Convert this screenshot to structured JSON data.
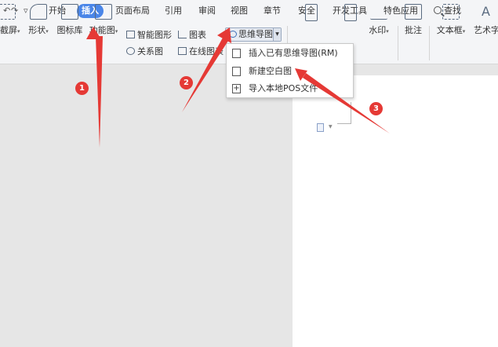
{
  "menubar": {
    "quick_access": [
      "↶",
      "↷",
      "▿"
    ],
    "tabs": [
      {
        "label": "开始"
      },
      {
        "label": "插入",
        "active": true
      },
      {
        "label": "页面布局"
      },
      {
        "label": "引用"
      },
      {
        "label": "审阅"
      },
      {
        "label": "视图"
      },
      {
        "label": "章节"
      },
      {
        "label": "安全"
      },
      {
        "label": "开发工具"
      },
      {
        "label": "特色应用"
      }
    ],
    "search_label": "查找"
  },
  "ribbon": {
    "screenshot_label": "截屏",
    "shape_label": "形状",
    "icon_library_label": "图标库",
    "function_label": "功能图",
    "smart_graphic_label": "智能图形",
    "chart_label": "图表",
    "relation_label": "关系图",
    "online_chart_label": "在线图表",
    "mindmap_label": "思维导图",
    "watermark_label": "水印",
    "comment_label": "批注",
    "textbox_label": "文本框",
    "art_text_label": "艺术字"
  },
  "mindmap_menu": {
    "items": [
      {
        "label": "插入已有思维导图(RM)",
        "icon": "mindmap-file-icon"
      },
      {
        "label": "新建空白图",
        "icon": "new-blank-icon"
      },
      {
        "label": "导入本地POS文件",
        "icon": "import-plus-icon"
      }
    ]
  },
  "annotations": {
    "steps": [
      "1",
      "2",
      "3"
    ],
    "color": "#e53935"
  },
  "colors": {
    "active_tab": "#4a86e8",
    "toolbar_bg": "#f4f5f7",
    "canvas_bg": "#e6e6e6"
  }
}
